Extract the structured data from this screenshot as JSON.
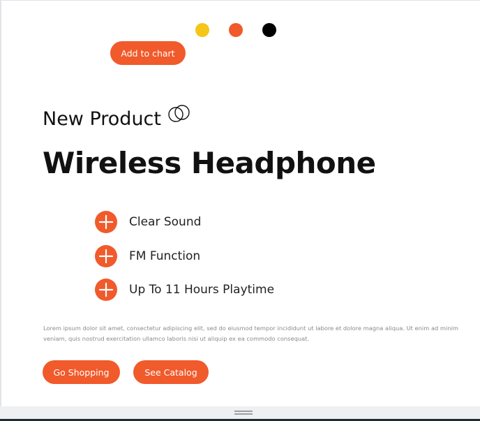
{
  "color_options": [
    {
      "name": "yellow",
      "color": "#f5c518"
    },
    {
      "name": "orange",
      "color": "#f15a2b"
    },
    {
      "name": "black",
      "color": "#000000"
    }
  ],
  "cart_button": {
    "label": "Add to chart"
  },
  "hero": {
    "subtitle": "New Product",
    "title": "Wireless Headphone",
    "subtitle_icon": "interlocking-rings-icon"
  },
  "features": [
    {
      "label": "Clear Sound",
      "icon": "plus-circle-icon"
    },
    {
      "label": "FM Function",
      "icon": "plus-circle-icon"
    },
    {
      "label": "Up To 11 Hours Playtime",
      "icon": "plus-circle-icon"
    }
  ],
  "description": "Lorem ipsum dolor sit amet, consectetur adipiscing elit, sed do eiusmod tempor incididunt ut labore et dolore magna aliqua. Ut enim ad minim veniam, quis nostrud exercitation ullamco laboris nisi ut aliquip ex ea commodo consequat.",
  "actions": {
    "shop_label": "Go Shopping",
    "catalog_label": "See Catalog"
  },
  "theme": {
    "accent": "#f15a2b",
    "text": "#111111",
    "muted": "#8a8a8a"
  }
}
